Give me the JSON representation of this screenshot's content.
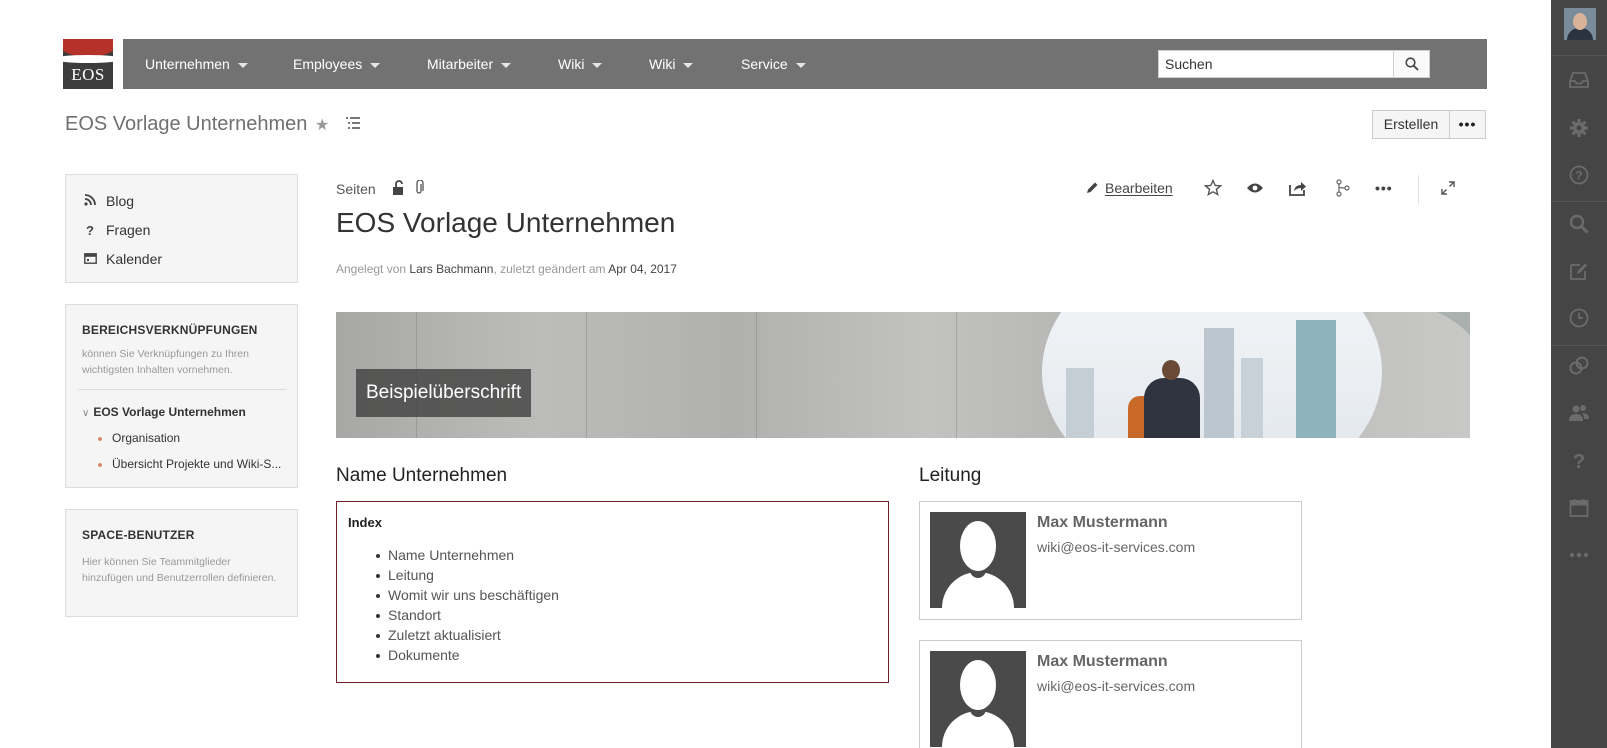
{
  "logo": {
    "text": "EOS"
  },
  "nav": {
    "items": [
      {
        "label": "Unternehmen"
      },
      {
        "label": "Employees"
      },
      {
        "label": "Mitarbeiter"
      },
      {
        "label": "Wiki"
      },
      {
        "label": "Wiki"
      },
      {
        "label": "Service"
      }
    ],
    "search_value": "Suchen"
  },
  "space": {
    "title": "EOS Vorlage Unternehmen",
    "create_label": "Erstellen",
    "more_label": "•••"
  },
  "sidebar": {
    "links": [
      {
        "label": "Blog",
        "icon": "rss-icon"
      },
      {
        "label": "Fragen",
        "icon": "question-icon"
      },
      {
        "label": "Kalender",
        "icon": "calendar-icon"
      }
    ],
    "shortcuts_heading": "BEREICHSVERKNÜPFUNGEN",
    "shortcuts_desc": "können Sie Verknüpfungen zu Ihren wichtigsten Inhalten vornehmen.",
    "tree_root": "EOS Vorlage Unternehmen",
    "tree_children": [
      "Organisation",
      "Übersicht Projekte und Wiki-S..."
    ],
    "users_heading": "SPACE-BENUTZER",
    "users_desc": "Hier können Sie Teammitglieder hinzufügen und Benutzerrollen definieren."
  },
  "page": {
    "breadcrumb": "Seiten",
    "edit_label": "Bearbeiten",
    "title": "EOS Vorlage Unternehmen",
    "meta": {
      "created_by_prefix": "Angelegt von",
      "author": "Lars Bachmann",
      "changed_prefix": ", zuletzt geändert am",
      "date": "Apr 04, 2017"
    },
    "banner_label": "Beispielüberschrift",
    "left_heading": "Name Unternehmen",
    "right_heading": "Leitung",
    "index": {
      "title": "Index",
      "items": [
        "Name Unternehmen",
        "Leitung",
        "Womit wir uns beschäftigen",
        "Standort",
        "Zuletzt aktualisiert",
        "Dokumente"
      ]
    },
    "people": [
      {
        "name": "Max Mustermann",
        "email": "wiki@eos-it-services.com"
      },
      {
        "name": "Max Mustermann",
        "email": "wiki@eos-it-services.com"
      }
    ]
  },
  "rail": {
    "icons": [
      "inbox-icon",
      "gear-icon",
      "help-icon",
      "search-icon",
      "edit-icon",
      "clock-icon",
      "link-icon",
      "people-icon",
      "question-icon",
      "calendar-icon",
      "more-icon"
    ]
  },
  "colors": {
    "navbar": "#737273",
    "rail": "#454545",
    "logo_red": "#b5322a",
    "index_border": "#6b1f2a"
  }
}
